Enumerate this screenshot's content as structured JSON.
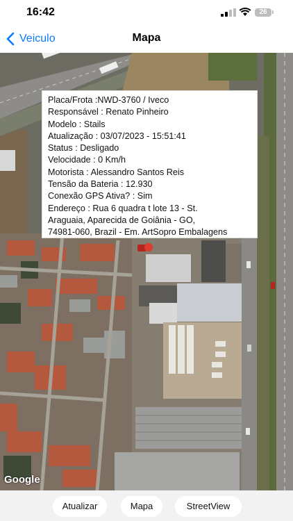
{
  "status_bar": {
    "time": "16:42",
    "battery": "26"
  },
  "nav": {
    "back_label": "Veiculo",
    "title": "Mapa"
  },
  "info": {
    "plate": "Placa/Frota :NWD-3760 / Iveco",
    "responsible": "Responsável : Renato Pinheiro",
    "model": "Modelo : Stails",
    "updated": "Atualização : 03/07/2023 - 15:51:41",
    "status": "Status : Desligado",
    "speed": "Velocidade : 0 Km/h",
    "driver": "Motorista : Alessandro Santos Reis",
    "battery_voltage": "Tensão da Bateria : 12.930",
    "gps": "Conexão GPS Ativa? : Sim",
    "address_1": "Endereço : Rua 6 quadra t lote 13 - St.",
    "address_2": "Araguaia, Aparecida de Goiânia - GO,",
    "address_3": "74981-060, Brazil - Em. ArtSopro Embalagens"
  },
  "map": {
    "attribution": "Google"
  },
  "buttons": {
    "refresh": "Atualizar",
    "map": "Mapa",
    "street_view": "StreetView"
  }
}
